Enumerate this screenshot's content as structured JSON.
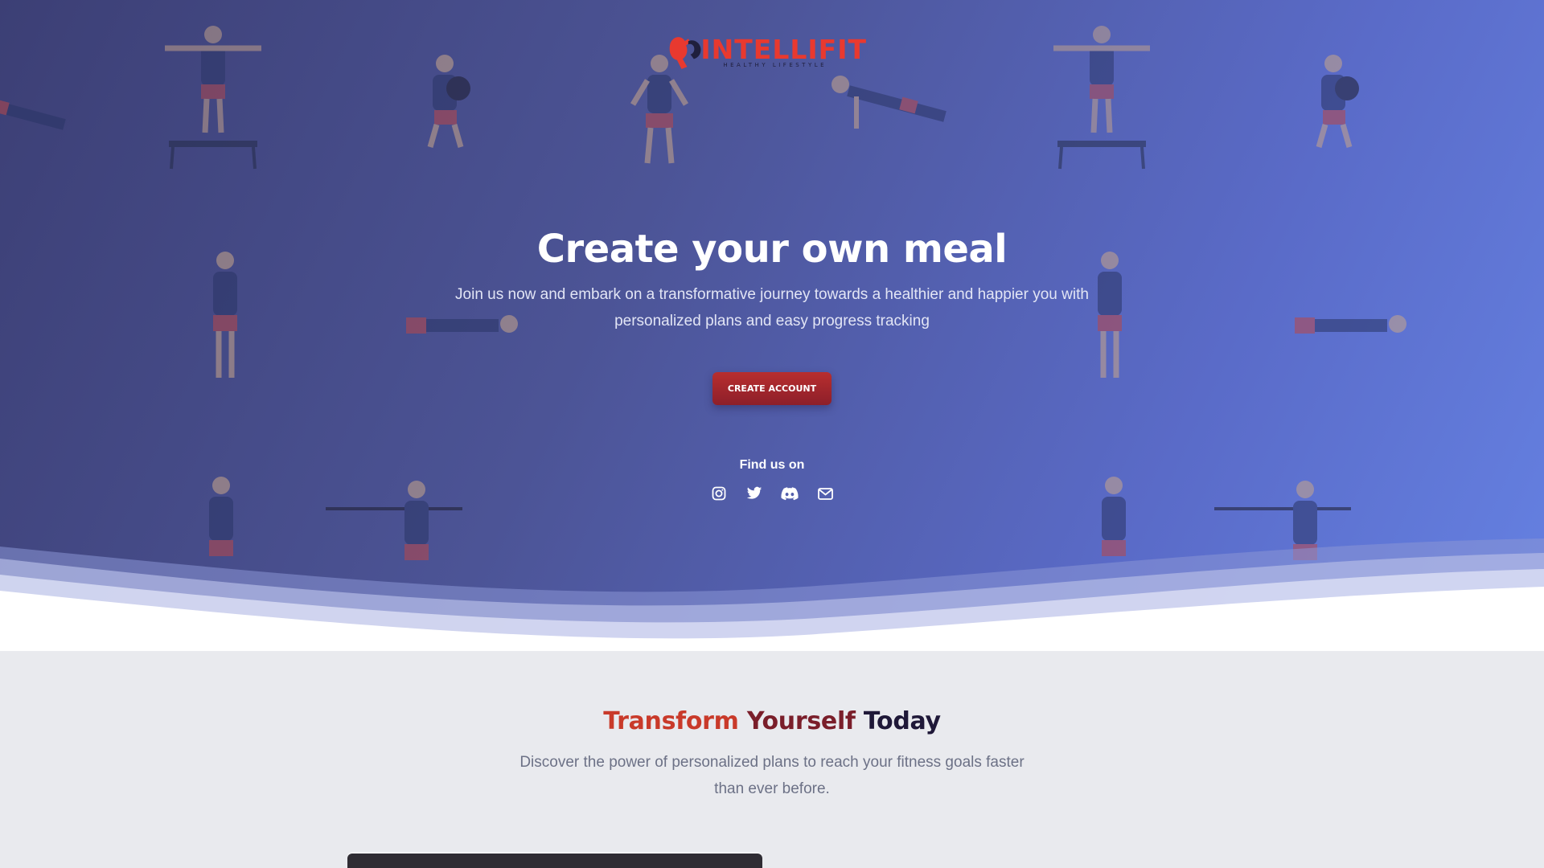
{
  "brand": {
    "name": "INTELLIFIT",
    "tagline": "HEALTHY LIFESTYLE",
    "primary_color": "#e8392f"
  },
  "hero": {
    "title": "Create your own meal",
    "subtitle": "Join us now and embark on a transformative journey towards a healthier and happier you with personalized plans and easy progress tracking",
    "cta_label": "CREATE ACCOUNT",
    "find_us_label": "Find us on",
    "socials": [
      {
        "icon": "instagram-icon"
      },
      {
        "icon": "twitter-icon"
      },
      {
        "icon": "discord-icon"
      },
      {
        "icon": "mail-icon"
      }
    ],
    "background_gradient": [
      "#3c3f75",
      "#6581e2"
    ]
  },
  "section": {
    "title_part1": "Transform",
    "title_part2": "Yourself",
    "title_part3": "Today",
    "subtitle": "Discover the power of personalized plans to reach your fitness goals faster than ever before."
  }
}
